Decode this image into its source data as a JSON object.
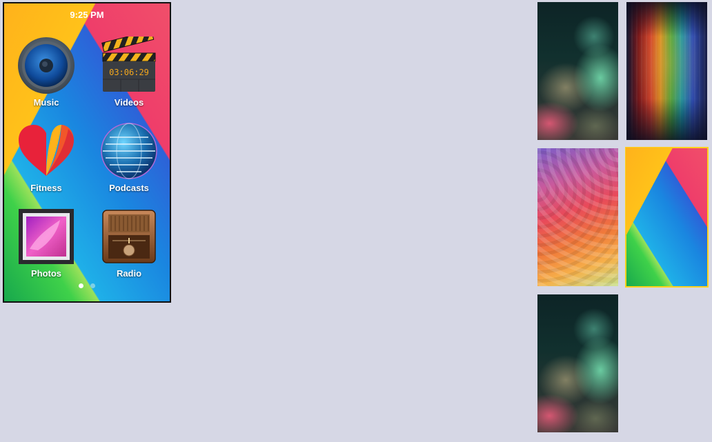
{
  "status_bar": {
    "time": "9:25 PM"
  },
  "apps": [
    {
      "label": "Music",
      "icon": "speaker-icon"
    },
    {
      "label": "Videos",
      "icon": "clapperboard-icon",
      "timer": "03:06:29"
    },
    {
      "label": "Fitness",
      "icon": "heart-icon"
    },
    {
      "label": "Podcasts",
      "icon": "globe-icon"
    },
    {
      "label": "Photos",
      "icon": "photo-frame-icon"
    },
    {
      "label": "Radio",
      "icon": "radio-icon"
    }
  ],
  "page_indicator": {
    "current": 1,
    "total": 2,
    "active_color": "#ffffff",
    "inactive_color": "#7fd0e6"
  },
  "wallpapers": [
    {
      "name": "bokeh-teal",
      "selected": false
    },
    {
      "name": "rainbow-streaks",
      "selected": false
    },
    {
      "name": "circles-sunset",
      "selected": false
    },
    {
      "name": "material-color",
      "selected": true
    },
    {
      "name": "bokeh-teal",
      "selected": false
    }
  ],
  "colors": {
    "background": "#d6d7e5",
    "selection": "#ffd21c"
  }
}
